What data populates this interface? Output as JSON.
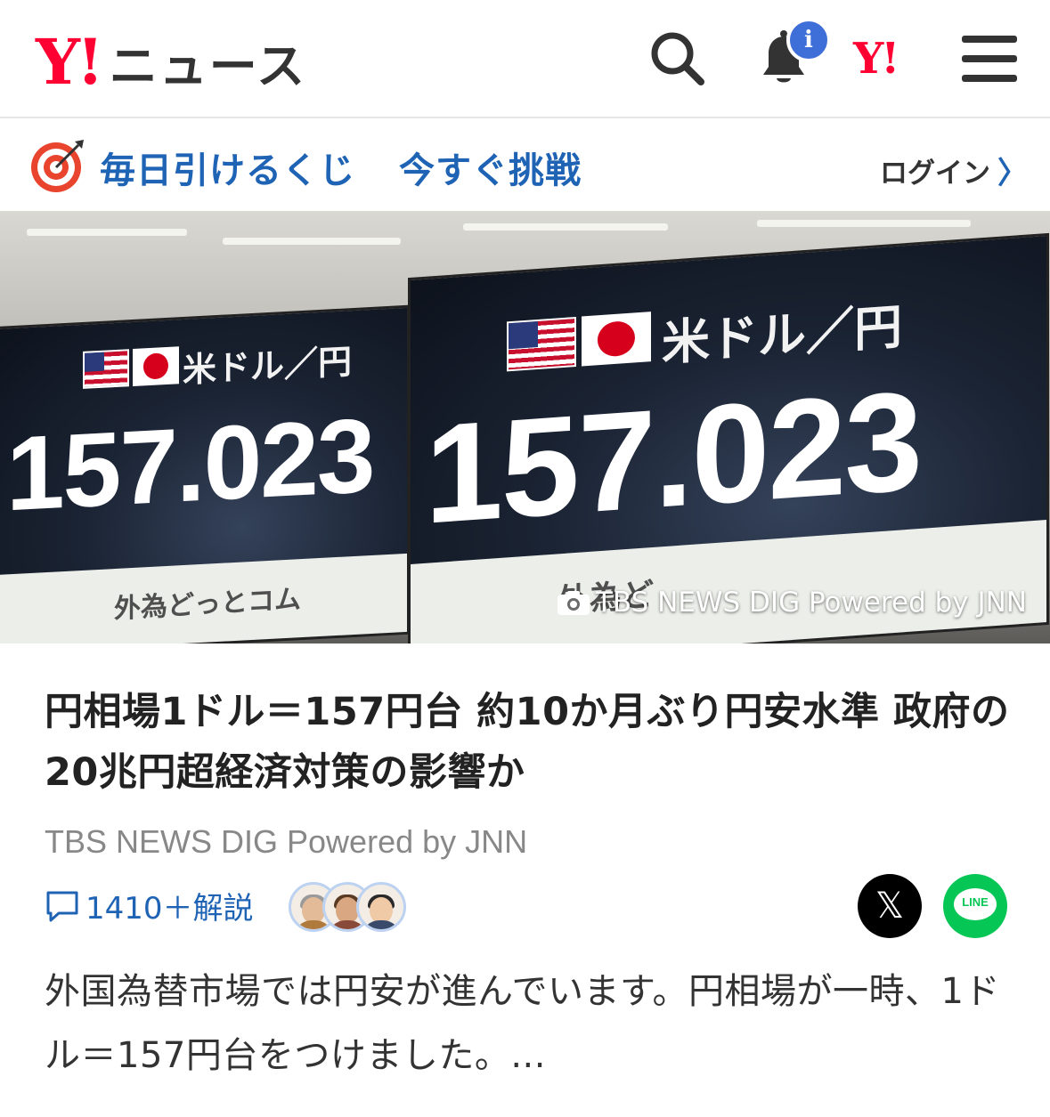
{
  "header": {
    "logo_y": "Y!",
    "logo_text": "ニュース",
    "notification_badge": "i",
    "yahoo_mini": "Y!"
  },
  "lottery": {
    "text": "毎日引けるくじ",
    "cta": "今すぐ挑戦",
    "login": "ログイン",
    "login_chevron": "〉"
  },
  "hero": {
    "pair_label": "米ドル／円",
    "rate": "157.023",
    "rate_partial": "7",
    "broker": "外為どっとコム",
    "broker_partial": "外為ど",
    "photo_credit": "TBS NEWS DIG Powered by JNN"
  },
  "article": {
    "headline": "円相場1ドル＝157円台 約10か月ぶり円安水準  政府の20兆円超経済対策の影響か",
    "source": "TBS NEWS DIG Powered by JNN",
    "comment_count": "1410＋解説",
    "body": "外国為替市場では円安が進んでいます。円相場が一時、1ドル＝157円台をつけました。..."
  },
  "share": {
    "x_glyph": "𝕏",
    "line_label": "LINE"
  },
  "colors": {
    "brand_red": "#ff0033",
    "link_blue": "#1f63b5",
    "badge_blue": "#3e6ed8",
    "line_green": "#06c755"
  },
  "icons": [
    "search-icon",
    "bell-icon",
    "menu-icon",
    "target-icon",
    "camera-icon",
    "comment-icon",
    "x-icon",
    "line-icon"
  ]
}
